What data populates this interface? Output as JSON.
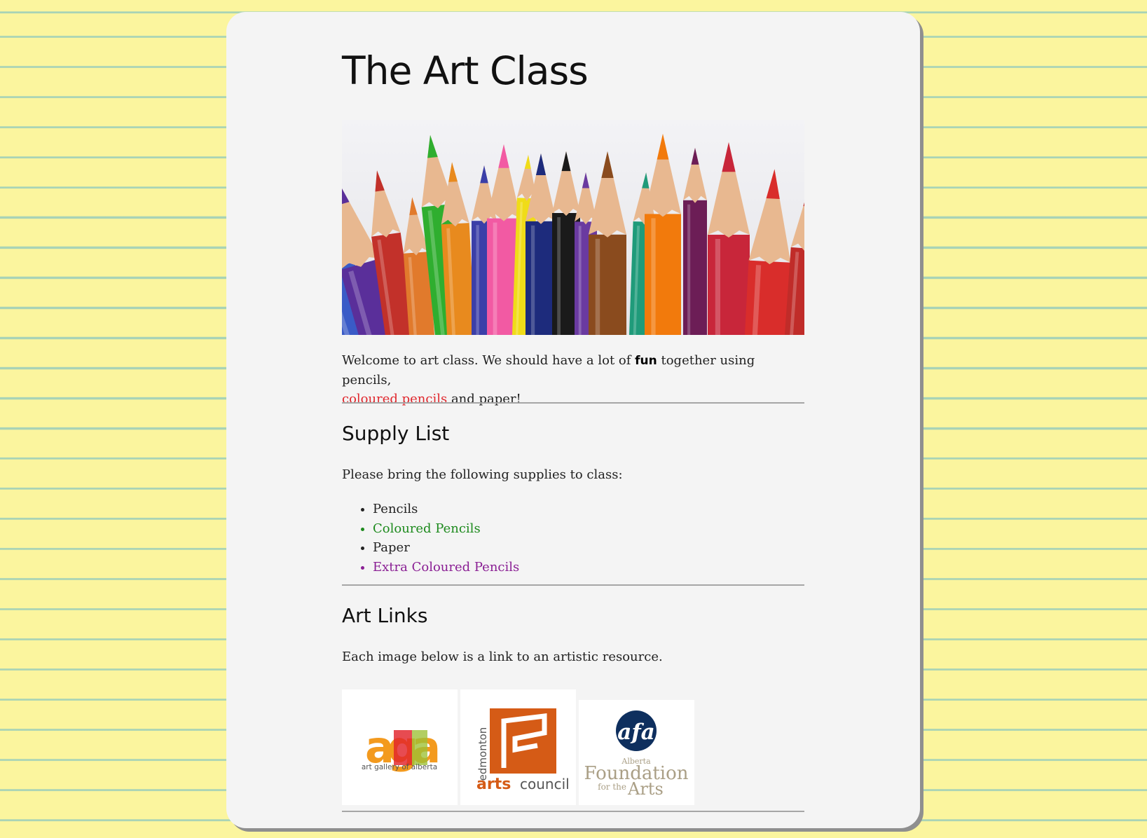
{
  "page": {
    "title": "The Art Class"
  },
  "hero": {
    "image_alt": "coloured pencils"
  },
  "intro": {
    "part1": "Welcome to art class. We should have a lot of ",
    "emphasis": "fun",
    "part2": " together using pencils,",
    "highlight": "coloured pencils",
    "part3": " and paper!"
  },
  "supply": {
    "heading": "Supply List",
    "description": "Please bring the following supplies to class:",
    "items": [
      {
        "label": "Pencils",
        "color": "#222222"
      },
      {
        "label": "Coloured Pencils",
        "color": "#1d8a1d"
      },
      {
        "label": "Paper",
        "color": "#222222"
      },
      {
        "label": "Extra Coloured Pencils",
        "color": "#8a1f94"
      }
    ]
  },
  "links": {
    "heading": "Art Links",
    "description": "Each image below is a link to an artistic resource.",
    "logos": [
      {
        "name": "agaa",
        "brand": "aga",
        "caption": "art gallery of alberta"
      },
      {
        "name": "edmonton arts council",
        "city": "edmonton",
        "word1": "arts",
        "word2": "council"
      },
      {
        "name": "afa",
        "brand": "afa",
        "line1": "Alberta",
        "line2": "Foundation",
        "line3a": "for the",
        "line3b": "Arts"
      }
    ]
  },
  "colors": {
    "background": "#fbf59e",
    "card": "#f4f4f4",
    "highlight_red": "#e0262c",
    "green": "#1d8a1d",
    "purple": "#8a1f94",
    "eac_orange": "#d55b16",
    "afa_navy": "#0e2f5e"
  }
}
